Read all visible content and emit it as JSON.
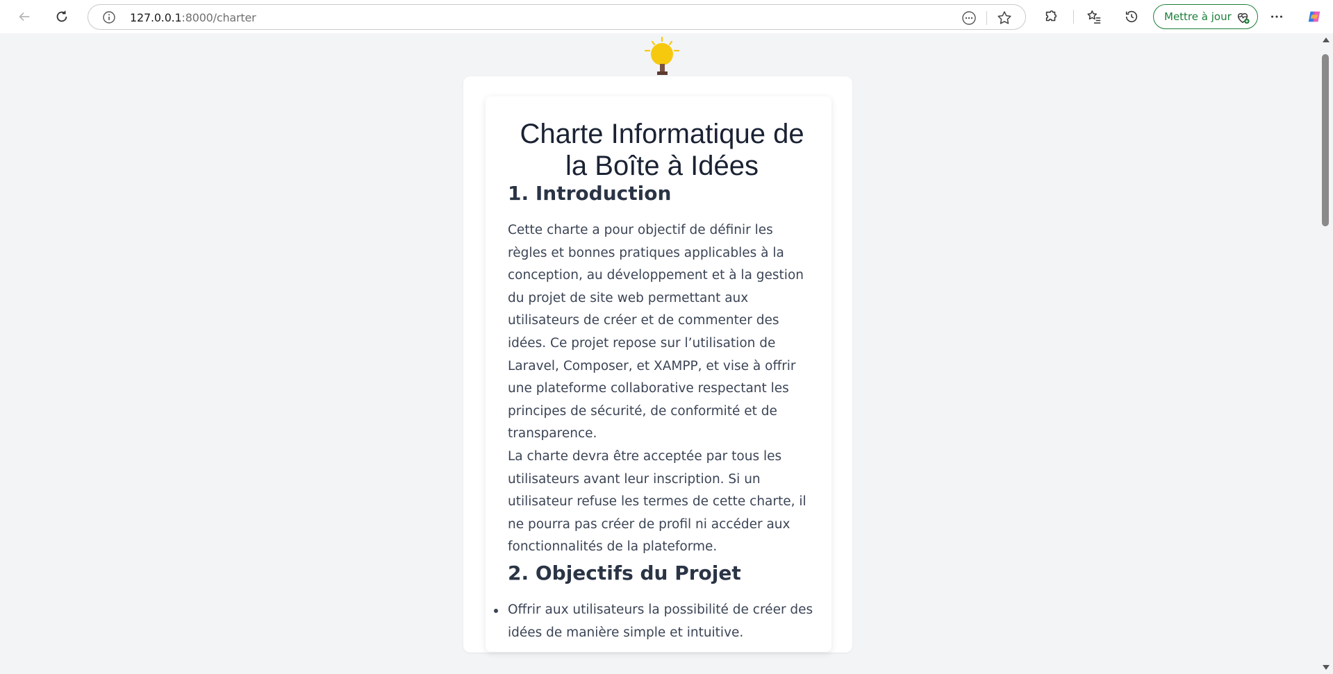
{
  "browser": {
    "url_host": "127.0.0.1",
    "url_path": ":8000/charter",
    "update_label": "Mettre à jour",
    "icons": {
      "back": "back-arrow-icon",
      "refresh": "refresh-icon",
      "info": "info-icon",
      "reader": "reader-mode-icon",
      "favorite": "star-icon",
      "extensions": "puzzle-icon",
      "favorites": "favorites-list-icon",
      "history": "history-icon",
      "update": "heart-pulse-icon",
      "more": "more-icon",
      "copilot": "copilot-icon"
    },
    "colors": {
      "update_accent": "#1a7f37"
    }
  },
  "page": {
    "logo_icon": "lightbulb-icon",
    "title": "Charte Informatique de la Boîte à Idées",
    "sections": [
      {
        "heading": "1. Introduction",
        "paragraphs": [
          "Cette charte a pour objectif de définir les règles et bonnes pratiques applicables à la conception, au développement et à la gestion du projet de site web permettant aux utilisateurs de créer et de commenter des idées. Ce projet repose sur l’utilisation de Laravel, Composer, et XAMPP, et vise à offrir une plateforme collaborative respectant les principes de sécurité, de conformité et de transparence.",
          "La charte devra être acceptée par tous les utilisateurs avant leur inscription. Si un utilisateur refuse les termes de cette charte, il ne pourra pas créer de profil ni accéder aux fonctionnalités de la plateforme."
        ]
      },
      {
        "heading": "2. Objectifs du Projet",
        "bullets": [
          "Offrir aux utilisateurs la possibilité de créer des idées de manière simple et intuitive."
        ]
      }
    ],
    "colors": {
      "background": "#f3f4f6",
      "card": "#ffffff",
      "heading": "#2a3445",
      "text": "#3b4455",
      "bulb": "#f6c90e"
    }
  }
}
